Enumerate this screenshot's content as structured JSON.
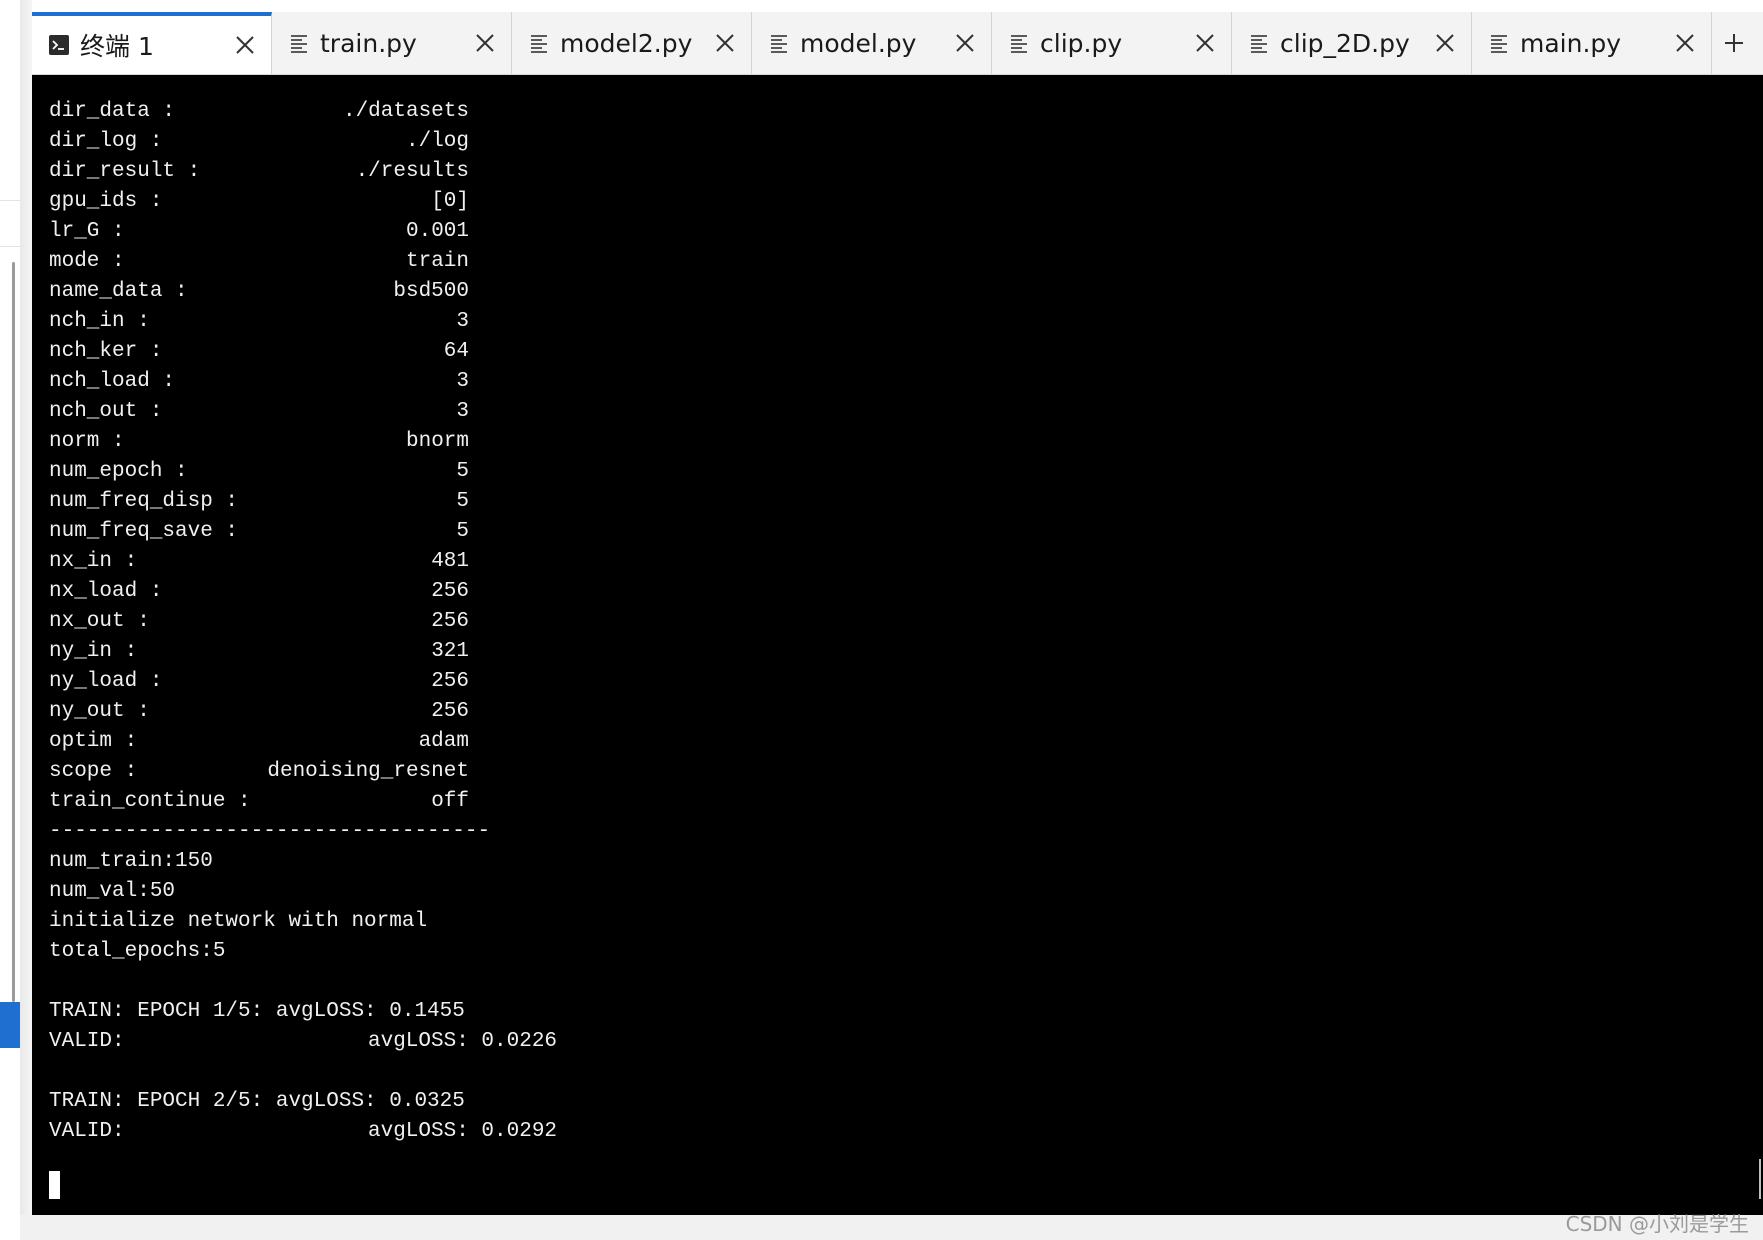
{
  "tabs": [
    {
      "label": "终端 1",
      "icon": "terminal-icon",
      "active": true
    },
    {
      "label": "train.py",
      "icon": "text-file-icon",
      "active": false
    },
    {
      "label": "model2.py",
      "icon": "text-file-icon",
      "active": false
    },
    {
      "label": "model.py",
      "icon": "text-file-icon",
      "active": false
    },
    {
      "label": "clip.py",
      "icon": "text-file-icon",
      "active": false
    },
    {
      "label": "clip_2D.py",
      "icon": "text-file-icon",
      "active": false
    },
    {
      "label": "main.py",
      "icon": "text-file-icon",
      "active": false
    }
  ],
  "new_tab_glyph": "+",
  "close_glyph": "×",
  "terminal": {
    "params": [
      {
        "key": "dir_data :",
        "value": "./datasets"
      },
      {
        "key": "dir_log :",
        "value": "./log"
      },
      {
        "key": "dir_result :",
        "value": "./results"
      },
      {
        "key": "gpu_ids :",
        "value": "[0]"
      },
      {
        "key": "lr_G :",
        "value": "0.001"
      },
      {
        "key": "mode :",
        "value": "train"
      },
      {
        "key": "name_data :",
        "value": "bsd500"
      },
      {
        "key": "nch_in :",
        "value": "3"
      },
      {
        "key": "nch_ker :",
        "value": "64"
      },
      {
        "key": "nch_load :",
        "value": "3"
      },
      {
        "key": "nch_out :",
        "value": "3"
      },
      {
        "key": "norm :",
        "value": "bnorm"
      },
      {
        "key": "num_epoch :",
        "value": "5"
      },
      {
        "key": "num_freq_disp :",
        "value": "5"
      },
      {
        "key": "num_freq_save :",
        "value": "5"
      },
      {
        "key": "nx_in :",
        "value": "481"
      },
      {
        "key": "nx_load :",
        "value": "256"
      },
      {
        "key": "nx_out :",
        "value": "256"
      },
      {
        "key": "ny_in :",
        "value": "321"
      },
      {
        "key": "ny_load :",
        "value": "256"
      },
      {
        "key": "ny_out :",
        "value": "256"
      },
      {
        "key": "optim :",
        "value": "adam"
      },
      {
        "key": "scope :",
        "value": "denoising_resnet"
      },
      {
        "key": "train_continue :",
        "value": "off"
      }
    ],
    "separator": "----------------------------------------",
    "info_lines": [
      "num_train:150",
      "num_val:50",
      "initialize network with normal",
      "total_epochs:5"
    ],
    "epochs": [
      {
        "train": "TRAIN: EPOCH 1/5: avgLOSS: 0.1455",
        "valid_label": "VALID:",
        "valid_value": "avgLOSS: 0.0226"
      },
      {
        "train": "TRAIN: EPOCH 2/5: avgLOSS: 0.0325",
        "valid_label": "VALID:",
        "valid_value": "avgLOSS: 0.0292"
      }
    ]
  },
  "watermark": "CSDN @小刘是学生"
}
